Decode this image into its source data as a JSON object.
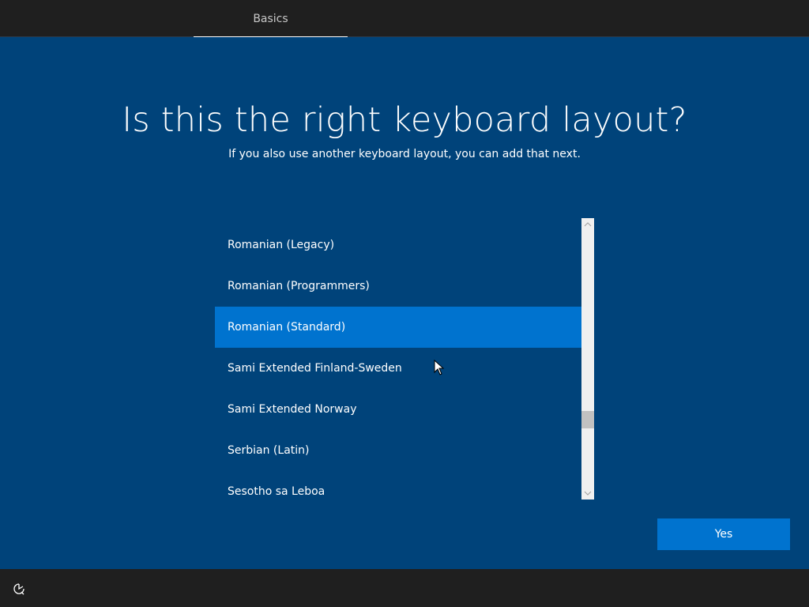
{
  "header": {
    "tabs": [
      {
        "label": "Basics",
        "active": true
      }
    ]
  },
  "main": {
    "title": "Is this the right keyboard layout?",
    "subtitle": "If you also use another keyboard layout, you can add that next."
  },
  "layout_list": {
    "items": [
      {
        "label": "Romanian (Legacy)",
        "selected": false
      },
      {
        "label": "Romanian (Programmers)",
        "selected": false
      },
      {
        "label": "Romanian (Standard)",
        "selected": true
      },
      {
        "label": "Sami Extended Finland-Sweden",
        "selected": false
      },
      {
        "label": "Sami Extended Norway",
        "selected": false
      },
      {
        "label": "Serbian (Latin)",
        "selected": false
      },
      {
        "label": "Sesotho sa Leboa",
        "selected": false
      }
    ],
    "scroll_up_icon": "chevron-up-icon",
    "scroll_down_icon": "chevron-down-icon"
  },
  "actions": {
    "yes_label": "Yes"
  },
  "footer": {
    "accessibility_icon": "ease-of-access-icon"
  },
  "colors": {
    "background": "#00437a",
    "bar": "#1f1f1f",
    "accent": "#0073cf",
    "text": "#ffffff"
  }
}
